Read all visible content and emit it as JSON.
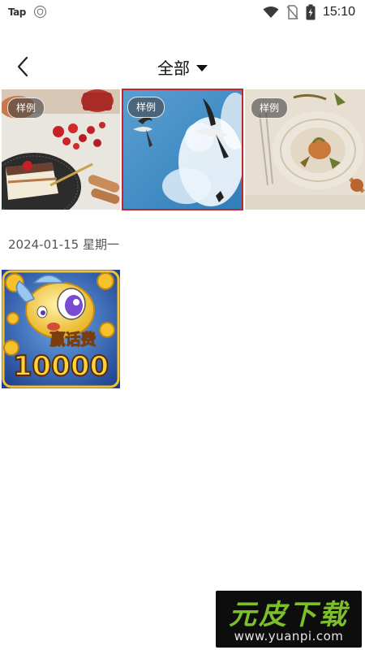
{
  "status_bar": {
    "app_badge": "Tap",
    "time": "15:10",
    "icons": [
      "wifi-icon",
      "no-sim-icon",
      "battery-charging-icon"
    ]
  },
  "header": {
    "back_icon": "chevron-left-icon",
    "title": "全部",
    "dropdown_icon": "caret-down-icon"
  },
  "samples": {
    "badge": "样例",
    "items": [
      {
        "subject": "dessert",
        "selected": false
      },
      {
        "subject": "seagulls-sky",
        "selected": true
      },
      {
        "subject": "table-setting",
        "selected": false
      }
    ],
    "selected_color": "#c4262e"
  },
  "gallery": {
    "date": "2024-01-15 星期一",
    "photo_text": "赢话费",
    "photo_number": "10000"
  },
  "watermark": {
    "title": "元皮下载",
    "url": "www.yuanpi.com"
  }
}
